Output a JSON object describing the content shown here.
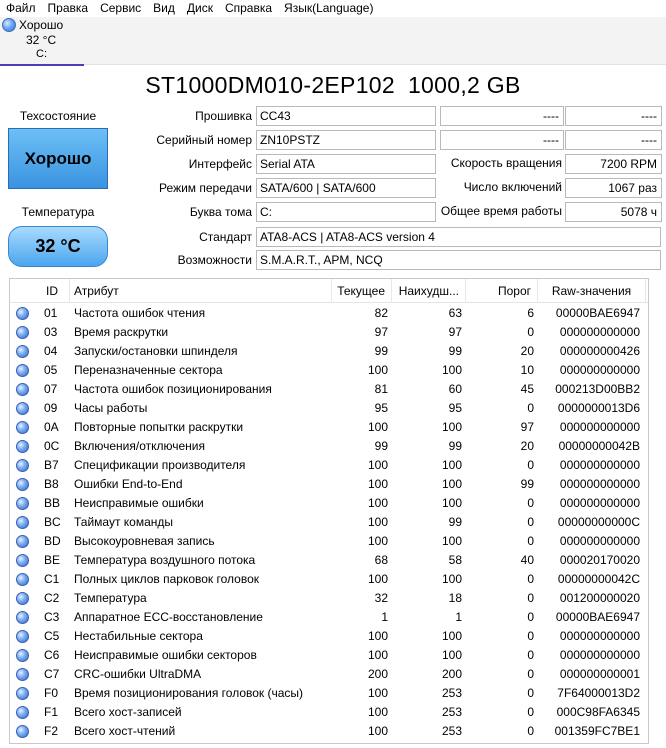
{
  "menu": [
    "Файл",
    "Правка",
    "Сервис",
    "Вид",
    "Диск",
    "Справка",
    "Язык(Language)"
  ],
  "drive_tab": {
    "status": "Хорошо",
    "temp": "32 °C",
    "letter": "C:"
  },
  "title": {
    "model": "ST1000DM010-2EP102",
    "size": "1000,2 GB"
  },
  "health": {
    "label": "Техсостояние",
    "value": "Хорошо",
    "color": "#3a93e0"
  },
  "temperature": {
    "label": "Температура",
    "value": "32 °C"
  },
  "info_left": [
    {
      "label": "Прошивка",
      "value": "CC43"
    },
    {
      "label": "Серийный номер",
      "value": "ZN10PSTZ"
    },
    {
      "label": "Интерфейс",
      "value": "Serial ATA"
    },
    {
      "label": "Режим передачи",
      "value": "SATA/600 | SATA/600"
    },
    {
      "label": "Буква тома",
      "value": "C:"
    },
    {
      "label": "Стандарт",
      "value": "ATA8-ACS | ATA8-ACS version 4"
    },
    {
      "label": "Возможности",
      "value": "S.M.A.R.T., APM, NCQ"
    }
  ],
  "info_right": [
    {
      "label": "----",
      "value": "----"
    },
    {
      "label": "----",
      "value": "----"
    },
    {
      "label": "Скорость вращения",
      "value": "7200 RPM"
    },
    {
      "label": "Число включений",
      "value": "1067 раз"
    },
    {
      "label": "Общее время работы",
      "value": "5078 ч"
    }
  ],
  "table": {
    "headers": [
      "ID",
      "Атрибут",
      "Текущее",
      "Наихудш...",
      "Порог",
      "Raw-значения"
    ],
    "rows": [
      {
        "id": "01",
        "name": "Частота ошибок чтения",
        "cur": "82",
        "worst": "63",
        "thr": "6",
        "raw": "00000BAE6947"
      },
      {
        "id": "03",
        "name": "Время раскрутки",
        "cur": "97",
        "worst": "97",
        "thr": "0",
        "raw": "000000000000"
      },
      {
        "id": "04",
        "name": "Запуски/остановки шпинделя",
        "cur": "99",
        "worst": "99",
        "thr": "20",
        "raw": "000000000426"
      },
      {
        "id": "05",
        "name": "Переназначенные сектора",
        "cur": "100",
        "worst": "100",
        "thr": "10",
        "raw": "000000000000"
      },
      {
        "id": "07",
        "name": "Частота ошибок позиционирования",
        "cur": "81",
        "worst": "60",
        "thr": "45",
        "raw": "000213D00BB2"
      },
      {
        "id": "09",
        "name": "Часы работы",
        "cur": "95",
        "worst": "95",
        "thr": "0",
        "raw": "0000000013D6"
      },
      {
        "id": "0A",
        "name": "Повторные попытки раскрутки",
        "cur": "100",
        "worst": "100",
        "thr": "97",
        "raw": "000000000000"
      },
      {
        "id": "0C",
        "name": "Включения/отключения",
        "cur": "99",
        "worst": "99",
        "thr": "20",
        "raw": "00000000042B"
      },
      {
        "id": "B7",
        "name": "Спецификации производителя",
        "cur": "100",
        "worst": "100",
        "thr": "0",
        "raw": "000000000000"
      },
      {
        "id": "B8",
        "name": "Ошибки End-to-End",
        "cur": "100",
        "worst": "100",
        "thr": "99",
        "raw": "000000000000"
      },
      {
        "id": "BB",
        "name": "Неисправимые ошибки",
        "cur": "100",
        "worst": "100",
        "thr": "0",
        "raw": "000000000000"
      },
      {
        "id": "BC",
        "name": "Таймаут команды",
        "cur": "100",
        "worst": "99",
        "thr": "0",
        "raw": "00000000000C"
      },
      {
        "id": "BD",
        "name": "Высокоуровневая запись",
        "cur": "100",
        "worst": "100",
        "thr": "0",
        "raw": "000000000000"
      },
      {
        "id": "BE",
        "name": "Температура воздушного потока",
        "cur": "68",
        "worst": "58",
        "thr": "40",
        "raw": "000020170020"
      },
      {
        "id": "C1",
        "name": "Полных циклов парковок головок",
        "cur": "100",
        "worst": "100",
        "thr": "0",
        "raw": "00000000042C"
      },
      {
        "id": "C2",
        "name": "Температура",
        "cur": "32",
        "worst": "18",
        "thr": "0",
        "raw": "001200000020"
      },
      {
        "id": "C3",
        "name": "Аппаратное ECC-восстановление",
        "cur": "1",
        "worst": "1",
        "thr": "0",
        "raw": "00000BAE6947"
      },
      {
        "id": "C5",
        "name": "Нестабильные сектора",
        "cur": "100",
        "worst": "100",
        "thr": "0",
        "raw": "000000000000"
      },
      {
        "id": "C6",
        "name": "Неисправимые ошибки секторов",
        "cur": "100",
        "worst": "100",
        "thr": "0",
        "raw": "000000000000"
      },
      {
        "id": "C7",
        "name": "CRC-ошибки UltraDMA",
        "cur": "200",
        "worst": "200",
        "thr": "0",
        "raw": "000000000001"
      },
      {
        "id": "F0",
        "name": "Время позиционирования головок (часы)",
        "cur": "100",
        "worst": "253",
        "thr": "0",
        "raw": "7F64000013D2"
      },
      {
        "id": "F1",
        "name": "Всего хост-записей",
        "cur": "100",
        "worst": "253",
        "thr": "0",
        "raw": "000C98FA6345"
      },
      {
        "id": "F2",
        "name": "Всего хост-чтений",
        "cur": "100",
        "worst": "253",
        "thr": "0",
        "raw": "001359FC7BE1"
      }
    ]
  }
}
